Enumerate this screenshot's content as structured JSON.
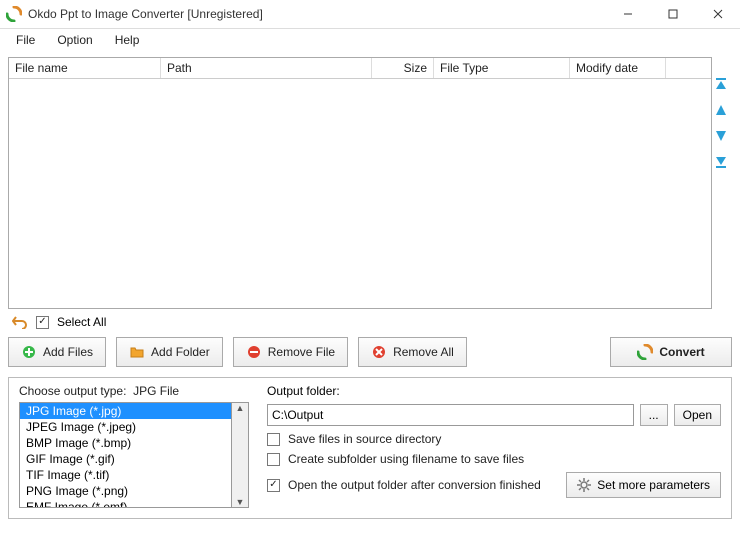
{
  "title": "Okdo Ppt to Image Converter [Unregistered]",
  "menu": {
    "file": "File",
    "option": "Option",
    "help": "Help"
  },
  "columns": {
    "name": "File name",
    "path": "Path",
    "size": "Size",
    "type": "File Type",
    "date": "Modify date"
  },
  "select_all": "Select All",
  "select_all_checked": true,
  "buttons": {
    "add_files": "Add Files",
    "add_folder": "Add Folder",
    "remove_file": "Remove File",
    "remove_all": "Remove All",
    "convert": "Convert"
  },
  "output_type": {
    "label_prefix": "Choose output type:",
    "current": "JPG File",
    "options": [
      "JPG Image (*.jpg)",
      "JPEG Image (*.jpeg)",
      "BMP Image (*.bmp)",
      "GIF Image (*.gif)",
      "TIF Image (*.tif)",
      "PNG Image (*.png)",
      "EMF Image (*.emf)"
    ],
    "selected_index": 0
  },
  "output_folder": {
    "label": "Output folder:",
    "value": "C:\\Output",
    "browse": "...",
    "open": "Open"
  },
  "checks": {
    "save_in_source": {
      "label": "Save files in source directory",
      "checked": false
    },
    "create_subfolder": {
      "label": "Create subfolder using filename to save files",
      "checked": false
    },
    "open_after": {
      "label": "Open the output folder after conversion finished",
      "checked": true
    }
  },
  "set_more": "Set more parameters"
}
